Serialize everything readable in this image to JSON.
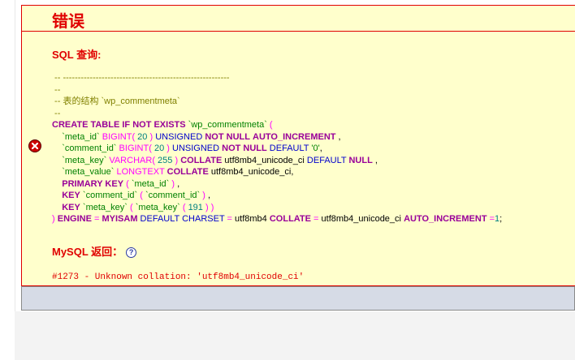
{
  "error": {
    "title": "错误",
    "sql_label": "SQL 查询:",
    "mysql_label": "MySQL 返回：",
    "help_icon": "?",
    "message": "#1273 - Unknown collation: 'utf8mb4_unicode_ci'"
  },
  "sql": {
    "c1": " -- --------------------------------------------------------",
    "c2": " --",
    "c3": " -- 表的结构 `wp_commentmeta`",
    "c4": " --",
    "create": "CREATE TABLE IF NOT EXISTS",
    "table_name": "`wp_commentmeta`",
    "open_paren": " (",
    "meta_id": "`meta_id`",
    "meta_id_type": "BIGINT",
    "meta_id_len": "20",
    "unsigned": "UNSIGNED",
    "not_null": "NOT NULL",
    "auto_increment": "AUTO_INCREMENT",
    "comment_id": "`comment_id`",
    "comment_id_type": "BIGINT",
    "comment_id_len": "20",
    "default_kw": "DEFAULT",
    "default_zero": "'0'",
    "meta_key": "`meta_key`",
    "meta_key_type": "VARCHAR",
    "meta_key_len": "255",
    "collate": "COLLATE",
    "collation": "utf8mb4_unicode_ci",
    "null_kw": "NULL",
    "meta_value": "`meta_value`",
    "meta_value_type": "LONGTEXT",
    "primary_key": "PRIMARY KEY",
    "key_kw": "KEY",
    "pk_col": "`meta_id`",
    "key1_name": "`comment_id`",
    "key1_col": "`comment_id`",
    "key2_name": "`meta_key`",
    "key2_col": "`meta_key`",
    "key2_len": "191",
    "engine_kw": "ENGINE",
    "engine": "MYISAM",
    "charset_kw": "DEFAULT CHARSET",
    "charset": "utf8mb4",
    "auto_inc_val": "1"
  },
  "icons": {
    "error": "error-x-icon",
    "help": "help-icon"
  },
  "colors": {
    "error_red": "#e00000",
    "panel_bg": "#ffffcc"
  }
}
